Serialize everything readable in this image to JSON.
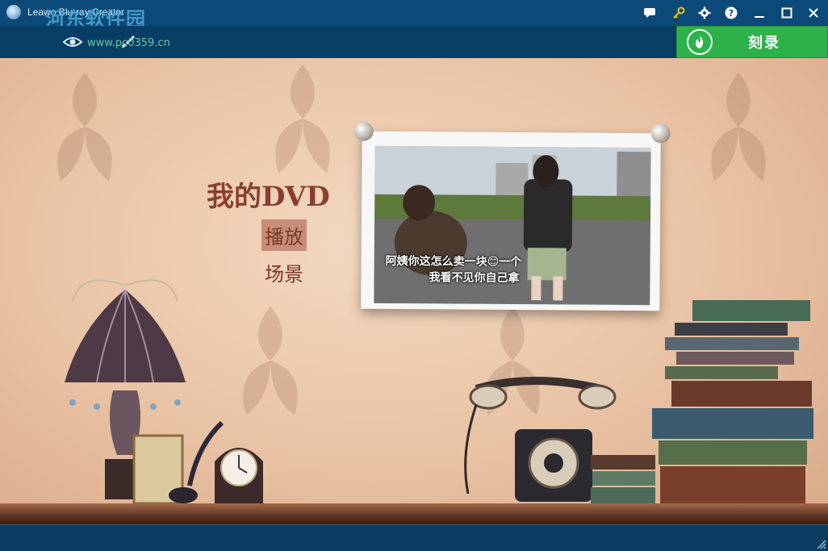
{
  "app": {
    "title": "Leawo Blu-ray Creator"
  },
  "watermark": {
    "text": "河东软件园",
    "url": "www.pc0359.cn"
  },
  "titlebar": {
    "buttons": [
      {
        "name": "feedback-icon"
      },
      {
        "name": "key-icon"
      },
      {
        "name": "gear-icon"
      },
      {
        "name": "help-icon"
      },
      {
        "name": "minimize-icon"
      },
      {
        "name": "maximize-icon"
      },
      {
        "name": "close-icon"
      }
    ]
  },
  "toolbar": {
    "preview_icon": "eye-icon",
    "edit_icon": "brush-icon",
    "burn_label": "刻录"
  },
  "menu": {
    "title": "我的DVD",
    "items": [
      {
        "label": "播放",
        "active": true
      },
      {
        "label": "场景",
        "active": false
      }
    ]
  },
  "photo": {
    "caption_line1": "阿姨你这怎么卖一块😊一个",
    "caption_line2": "我看不见你自己拿"
  },
  "colors": {
    "titlebar": "#0b4a78",
    "toolbar": "#083e64",
    "burn_button": "#2db14a",
    "menu_text": "#7a3a2a",
    "active_highlight": "#c88d78"
  }
}
